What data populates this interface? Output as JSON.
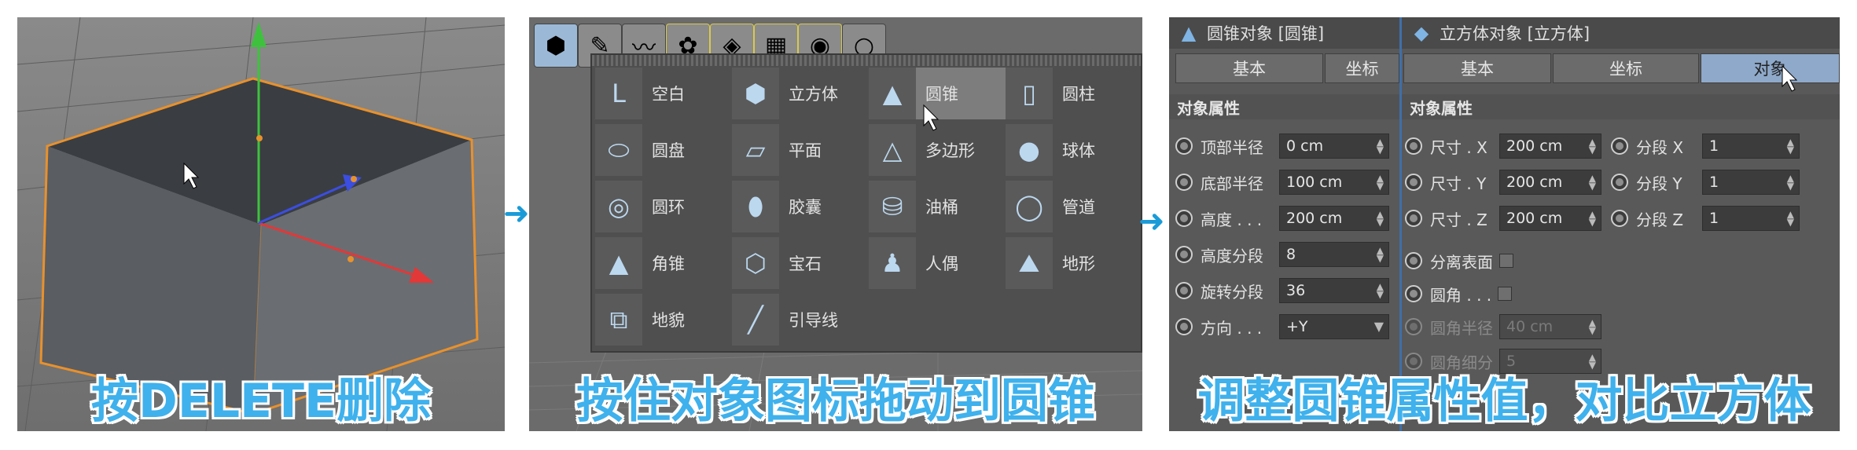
{
  "captions": {
    "step1": "按DELETE删除",
    "step2": "按住对象图标拖动到圆锥",
    "step3": "调整圆锥属性值，对比立方体"
  },
  "colors": {
    "caption": "#3fb1ec",
    "arrow": "#1a9bd8",
    "cube_outline": "#e8912c"
  },
  "step_arrow_icon": "arrow-right-icon",
  "panel2": {
    "toolbar": [
      "cube-icon",
      "pen-icon",
      "spline-icon",
      "array-icon",
      "deformer-icon",
      "floor-icon",
      "camera-icon",
      "light-icon"
    ],
    "menu_items": [
      {
        "label": "空白",
        "icon": "null-icon"
      },
      {
        "label": "立方体",
        "icon": "cube-icon"
      },
      {
        "label": "圆锥",
        "icon": "cone-icon",
        "highlighted": true
      },
      {
        "label": "圆柱",
        "icon": "cylinder-icon"
      },
      {
        "label": "圆盘",
        "icon": "disc-icon"
      },
      {
        "label": "平面",
        "icon": "plane-icon"
      },
      {
        "label": "多边形",
        "icon": "polygon-icon"
      },
      {
        "label": "球体",
        "icon": "sphere-icon"
      },
      {
        "label": "圆环",
        "icon": "torus-icon"
      },
      {
        "label": "胶囊",
        "icon": "capsule-icon"
      },
      {
        "label": "油桶",
        "icon": "oil-tank-icon"
      },
      {
        "label": "管道",
        "icon": "tube-icon"
      },
      {
        "label": "角锥",
        "icon": "pyramid-icon"
      },
      {
        "label": "宝石",
        "icon": "platonic-icon"
      },
      {
        "label": "人偶",
        "icon": "figure-icon"
      },
      {
        "label": "地形",
        "icon": "landscape-icon"
      },
      {
        "label": "地貌",
        "icon": "relief-icon"
      },
      {
        "label": "引导线",
        "icon": "guide-icon"
      }
    ]
  },
  "panel3": {
    "cone": {
      "title": "圆锥对象 [圆锥]",
      "tabs": [
        "基本",
        "坐标"
      ],
      "section": "对象属性",
      "fields": [
        {
          "label": "顶部半径",
          "value": "0 cm"
        },
        {
          "label": "底部半径",
          "value": "100 cm"
        },
        {
          "label": "高度 . . .",
          "value": "200 cm"
        },
        {
          "label": "高度分段",
          "value": "8"
        },
        {
          "label": "旋转分段",
          "value": "36"
        },
        {
          "label": "方向 . . .",
          "value": "+Y"
        }
      ]
    },
    "cube": {
      "title": "立方体对象 [立方体]",
      "tabs": [
        "基本",
        "坐标",
        "对象"
      ],
      "active_tab": "对象",
      "section": "对象属性",
      "size_fields": [
        {
          "label": "尺寸 . X",
          "value": "200 cm"
        },
        {
          "label": "尺寸 . Y",
          "value": "200 cm"
        },
        {
          "label": "尺寸 . Z",
          "value": "200 cm"
        }
      ],
      "segment_fields": [
        {
          "label": "分段 X",
          "value": "1"
        },
        {
          "label": "分段 Y",
          "value": "1"
        },
        {
          "label": "分段 Z",
          "value": "1"
        }
      ],
      "checks": [
        {
          "label": "分离表面"
        },
        {
          "label": "圆角 . . ."
        }
      ],
      "fillet_radius": {
        "label": "圆角半径",
        "value": "40 cm"
      },
      "fillet_subdiv": {
        "label": "圆角细分",
        "value": "5"
      }
    }
  }
}
